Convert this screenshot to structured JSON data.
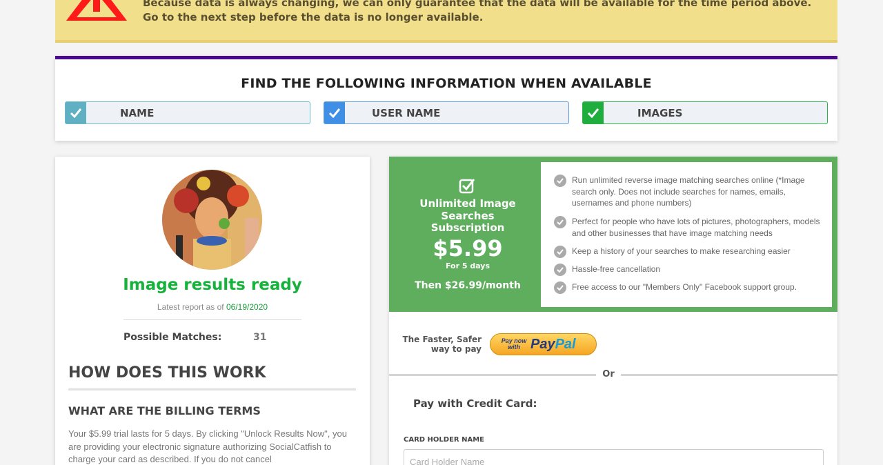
{
  "warning": {
    "text": "Because data is always changing, we can only guarantee that the data will be available for the time period above. Go to the next step before the data is no longer available."
  },
  "info_box": {
    "title": "FIND THE FOLLOWING INFORMATION WHEN AVAILABLE",
    "items": [
      {
        "label": "NAME",
        "color": "#5fb0c2"
      },
      {
        "label": "USER NAME",
        "color": "#3f8fe6"
      },
      {
        "label": "IMAGES",
        "color": "#1fae3e"
      }
    ]
  },
  "results": {
    "title": "Image results ready",
    "latest_prefix": "Latest report as of",
    "latest_date": "06/19/2020",
    "matches_label": "Possible Matches:",
    "matches_value": "31"
  },
  "how": {
    "title": "HOW DOES THIS WORK",
    "billing_title": "WHAT ARE THE BILLING TERMS",
    "billing_text": "Your $5.99 trial lasts for 5 days. By clicking \"Unlock Results Now\", you are providing your electronic signature authorizing SocialCatfish to charge your card as described. If you do not cancel"
  },
  "plan": {
    "name": "Unlimited Image Searches Subscription",
    "price": "$5.99",
    "duration": "For 5 days",
    "then": "Then $26.99/month",
    "accent_color": "#5fae5e"
  },
  "features": [
    "Run unlimited reverse image matching searches online (*Image search only. Does not include searches for names, emails, usernames and phone numbers)",
    "Perfect for people who have lots of pictures, photographers, models and other businesses that have image matching needs",
    "Keep a history of your searches to make researching easier",
    "Hassle-free cancellation",
    "Free access to our \"Members Only\" Facebook support group."
  ],
  "payment": {
    "faster_text": "The Faster, Safer way to pay",
    "paypal_prefix": "Pay now with",
    "paypal_pay": "Pay",
    "paypal_pal": "Pal",
    "or_text": "Or",
    "cc_title": "Pay with Credit Card:",
    "card_holder_label": "CARD HOLDER NAME",
    "card_holder_placeholder": "Card Holder Name"
  }
}
